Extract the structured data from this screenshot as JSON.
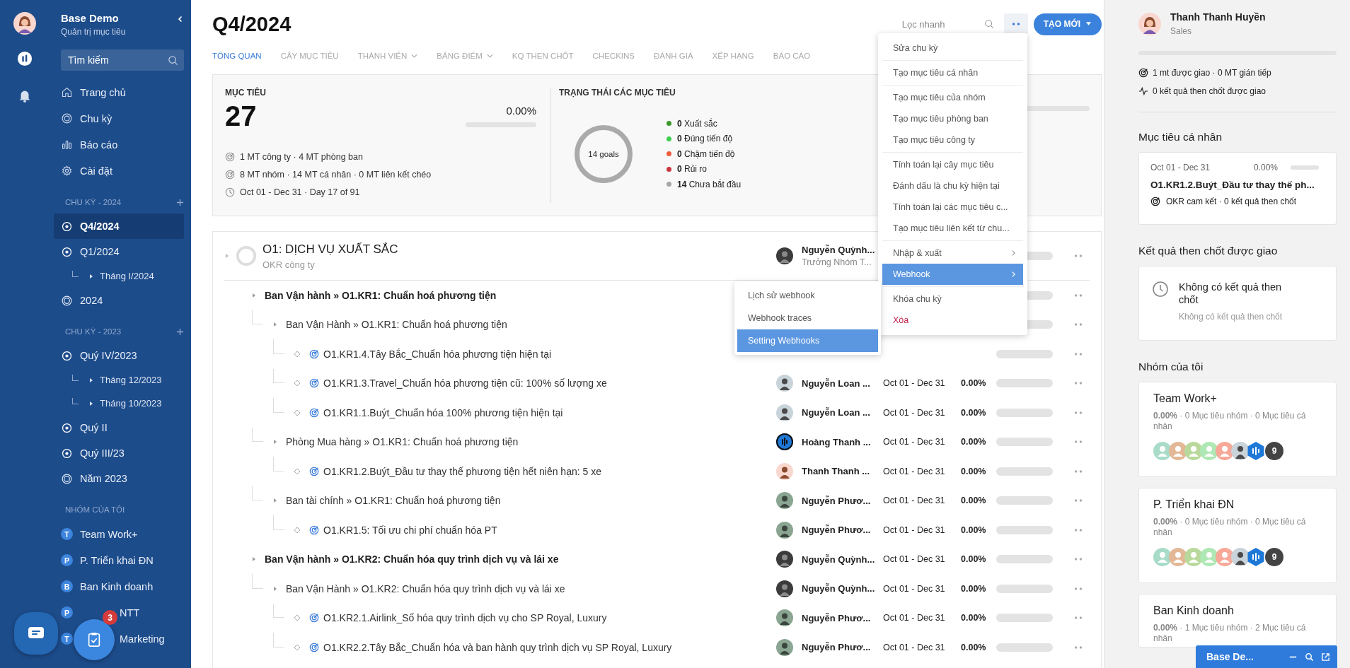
{
  "sidebar": {
    "title": "Base Demo",
    "subtitle": "Quản trị mục tiêu",
    "search": {
      "placeholder": "Tìm kiếm"
    },
    "nav": [
      {
        "label": "Trang chủ",
        "kind": "home"
      },
      {
        "label": "Chu kỳ",
        "kind": "cycle"
      },
      {
        "label": "Báo cáo",
        "kind": "report"
      },
      {
        "label": "Cài đặt",
        "kind": "settings"
      }
    ],
    "cycle_sections": [
      {
        "title": "CHU KỲ - 2024",
        "items": [
          {
            "label": "Q4/2024",
            "kind": "period",
            "selected": true
          },
          {
            "label": "Q1/2024",
            "kind": "period",
            "selected": false,
            "children": [
              {
                "label": "Tháng I/2024"
              }
            ]
          },
          {
            "label": "2024",
            "kind": "year",
            "selected": false
          }
        ]
      },
      {
        "title": "CHU KỲ - 2023",
        "items": [
          {
            "label": "Quý IV/2023",
            "kind": "period",
            "selected": false,
            "children": [
              {
                "label": "Tháng 12/2023"
              },
              {
                "label": "Tháng 10/2023"
              }
            ]
          },
          {
            "label": "Quý II",
            "kind": "period",
            "selected": false
          },
          {
            "label": "Quý III/23",
            "kind": "period",
            "selected": false
          },
          {
            "label": "Năm 2023",
            "kind": "year",
            "selected": false
          }
        ]
      }
    ],
    "groups_title": "NHÓM CỦA TÔI",
    "groups": [
      {
        "initial": "T",
        "label": "Team Work+"
      },
      {
        "initial": "P",
        "label": "P. Triển khai ĐN"
      },
      {
        "initial": "B",
        "label": "Ban Kinh doanh"
      },
      {
        "initial": "P",
        "label": "NTT"
      },
      {
        "initial": "T",
        "label": "Marketing"
      }
    ]
  },
  "floating": {
    "task_badge": "3"
  },
  "header": {
    "title": "Q4/2024",
    "filter": {
      "placeholder": "Lọc nhanh"
    },
    "create_button": "TẠO MỚI"
  },
  "tabs": [
    {
      "label": "TỔNG QUAN",
      "selected": true,
      "dropdown": false
    },
    {
      "label": "CÂY MỤC TIÊU",
      "selected": false,
      "dropdown": false
    },
    {
      "label": "THÀNH VIÊN",
      "selected": false,
      "dropdown": true
    },
    {
      "label": "BẢNG ĐIỂM",
      "selected": false,
      "dropdown": true
    },
    {
      "label": "KQ THEN CHỐT",
      "selected": false,
      "dropdown": false
    },
    {
      "label": "CHECKINS",
      "selected": false,
      "dropdown": false
    },
    {
      "label": "ĐÁNH GIÁ",
      "selected": false,
      "dropdown": false
    },
    {
      "label": "XẾP HẠNG",
      "selected": false,
      "dropdown": false
    },
    {
      "label": "BÁO CÁO",
      "selected": false,
      "dropdown": false
    }
  ],
  "summary": {
    "goals": {
      "title": "MỤC TIÊU",
      "count": "27",
      "percent": "0.00%",
      "level": 0,
      "lines": [
        {
          "kind": "target",
          "text": "1 MT công ty · 4 MT phòng ban"
        },
        {
          "kind": "target",
          "text": "8 MT nhóm · 14 MT cá nhân · 0 MT liên kết chéo"
        },
        {
          "kind": "clock",
          "text": "Oct 01 - Dec 31 · Day 17 of 91"
        }
      ]
    },
    "status": {
      "title": "TRẠNG THÁI CÁC MỤC TIÊU",
      "ring_label": "14 goals",
      "items": [
        {
          "count": "0",
          "label": "Xuất sắc",
          "color": "#3a9a2a"
        },
        {
          "count": "0",
          "label": "Đúng tiến độ",
          "color": "#3ccf4e"
        },
        {
          "count": "0",
          "label": "Chậm tiến độ",
          "color": "#ef5b3a"
        },
        {
          "count": "0",
          "label": "Rủi ro",
          "color": "#c9373f"
        },
        {
          "count": "14",
          "label": "Chưa bắt đầu",
          "color": "#a6a6a6"
        }
      ]
    },
    "column_3": {
      "level": 0
    }
  },
  "objective": {
    "title": "O1: DỊCH VỤ XUẤT SẮC",
    "subtitle": "OKR công ty",
    "owner": {
      "name": "Nguyễn Quỳnh...",
      "role": "Trưởng Nhóm T...",
      "kind": "dark"
    },
    "level": 0,
    "key_results": [
      {
        "kind": "branch",
        "label": "Ban Vận hành » O1.KR1: Chuẩn hoá phương tiện",
        "level": 0,
        "children": [
          {
            "kind": "branch",
            "label": "Ban Vận Hành » O1.KR1: Chuẩn hoá phương tiện",
            "level": 0,
            "children": [
              {
                "kind": "leaf",
                "label": "O1.KR1.4.Tây Bắc_Chuẩn hóa phương tiện hiện tại",
                "level": 0
              },
              {
                "kind": "leaf",
                "label": "O1.KR1.3.Travel_Chuẩn hóa phương tiện cũ: 100% số lượng xe",
                "owner": {
                  "name": "Nguyễn Loan ...",
                  "kind": "light"
                },
                "dates": "Oct 01 - Dec 31",
                "percent": "0.00%",
                "level": 0
              },
              {
                "kind": "leaf",
                "label": "O1.KR1.1.Buýt_Chuẩn hóa 100% phương tiện hiện tại",
                "owner": {
                  "name": "Nguyễn Loan ...",
                  "kind": "light"
                },
                "dates": "Oct 01 - Dec 31",
                "percent": "0.00%",
                "level": 0
              }
            ]
          },
          {
            "kind": "branch",
            "label": "Phòng Mua hàng » O1.KR1: Chuẩn hoá phương tiện",
            "owner": {
              "name": "Hoàng Thanh ...",
              "kind": "brand"
            },
            "dates": "Oct 01 - Dec 31",
            "percent": "0.00%",
            "level": 0,
            "children": [
              {
                "kind": "leaf",
                "label": "O1.KR1.2.Buýt_Đầu tư thay thế phương tiện hết niên hạn: 5 xe",
                "owner": {
                  "name": "Thanh Thanh ...",
                  "kind": "illustrated"
                },
                "dates": "Oct 01 - Dec 31",
                "percent": "0.00%",
                "level": 0
              }
            ]
          },
          {
            "kind": "branch",
            "label": "Ban tài chính » O1.KR1: Chuẩn hoá phương tiện",
            "owner": {
              "name": "Nguyễn Phươ...",
              "kind": "green"
            },
            "dates": "Oct 01 - Dec 31",
            "percent": "0.00%",
            "level": 0,
            "children": [
              {
                "kind": "leaf",
                "label": "O1.KR1.5: Tối ưu chi phí chuẩn hóa PT",
                "owner": {
                  "name": "Nguyễn Phươ...",
                  "kind": "green"
                },
                "dates": "Oct 01 - Dec 31",
                "percent": "0.00%",
                "level": 0
              }
            ]
          }
        ]
      },
      {
        "kind": "branch",
        "label": "Ban Vận hành » O1.KR2: Chuẩn hóa quy trình dịch vụ và lái xe",
        "owner": {
          "name": "Nguyễn Quỳnh...",
          "kind": "dark"
        },
        "dates": "Oct 01 - Dec 31",
        "percent": "0.00%",
        "level": 0,
        "children": [
          {
            "kind": "branch",
            "label": "Ban Vận Hành » O1.KR2: Chuẩn hóa quy trình dịch vụ và lái xe",
            "owner": {
              "name": "Nguyễn Quỳnh...",
              "kind": "dark"
            },
            "dates": "Oct 01 - Dec 31",
            "percent": "0.00%",
            "level": 0,
            "children": [
              {
                "kind": "leaf",
                "label": "O1.KR2.1.Airlink_Số hóa quy trình dịch vụ cho SP Royal, Luxury",
                "owner": {
                  "name": "Nguyễn Phươ...",
                  "kind": "green"
                },
                "dates": "Oct 01 - Dec 31",
                "percent": "0.00%",
                "level": 0
              },
              {
                "kind": "leaf",
                "label": "O1.KR2.2.Tây Bắc_Chuẩn hóa và ban hành quy trình dịch vụ SP Royal, Luxury",
                "owner": {
                  "name": "Nguyễn Phươ...",
                  "kind": "green"
                },
                "dates": "Oct 01 - Dec 31",
                "percent": "0.00%",
                "level": 0
              }
            ]
          }
        ]
      }
    ]
  },
  "menu": {
    "sections": [
      {
        "items": [
          {
            "label": "Sửa chu kỳ",
            "kind": "plain",
            "selected": false
          }
        ]
      },
      {
        "items": [
          {
            "label": "Tạo mục tiêu cá nhân",
            "kind": "plain",
            "selected": false
          }
        ]
      },
      {
        "items": [
          {
            "label": "Tạo mục tiêu của nhóm",
            "kind": "plain",
            "selected": false
          },
          {
            "label": "Tạo mục tiêu phòng ban",
            "kind": "plain",
            "selected": false
          },
          {
            "label": "Tạo mục tiêu công ty",
            "kind": "plain",
            "selected": false
          }
        ]
      },
      {
        "items": [
          {
            "label": "Tính toán lại cây mục tiêu",
            "kind": "plain",
            "selected": false
          },
          {
            "label": "Đánh dấu là chu kỳ hiện tại",
            "kind": "plain",
            "selected": false
          },
          {
            "label": "Tính toán lại các mục tiêu c...",
            "kind": "plain",
            "selected": false
          },
          {
            "label": "Tạo mục tiêu liên kết từ chu...",
            "kind": "plain",
            "selected": false
          }
        ]
      },
      {
        "items": [
          {
            "label": "Nhập & xuất",
            "kind": "parent",
            "selected": false
          },
          {
            "label": "Webhook",
            "kind": "parent",
            "selected": true
          }
        ]
      },
      {
        "items": [
          {
            "label": "Khóa chu kỳ",
            "kind": "plain",
            "selected": false
          },
          {
            "label": "Xóa",
            "kind": "danger",
            "selected": false
          }
        ]
      }
    ]
  },
  "submenu": {
    "items": [
      {
        "label": "Lịch sử webhook",
        "selected": false
      },
      {
        "label": "Webhook traces",
        "selected": false
      },
      {
        "label": "Setting Webhooks",
        "selected": true
      }
    ]
  },
  "profile": {
    "name": "Thanh Thanh Huyền",
    "role": "Sales",
    "level": 0,
    "stats": [
      {
        "kind": "target",
        "text": "1 mt được giao · 0 MT gián tiếp"
      },
      {
        "kind": "pulse",
        "text": "0 kết quả then chốt được giao"
      }
    ]
  },
  "personal_goals": {
    "title": "Mục tiêu cá nhân",
    "items": [
      {
        "dates": "Oct 01 - Dec 31",
        "percent": "0.00%",
        "level": 0,
        "title": "O1.KR1.2.Buýt_Đầu tư thay thế ph...",
        "meta": "OKR cam kết  ·  0 kết quả then chốt"
      }
    ]
  },
  "assigned_results": {
    "title": "Kết quả then chốt được giao",
    "empty_title": "Không có kết quả then chốt",
    "empty_text": "Không có kết quả then chốt"
  },
  "my_groups": {
    "title": "Nhóm của tôi",
    "items": [
      {
        "name": "Team Work+",
        "summary": "**0.00%** · 0 Mục tiêu nhóm · 0 Mục tiêu cá nhân",
        "members": [
          {
            "kind": "icon",
            "color": "#a8dcc9"
          },
          {
            "kind": "icon",
            "color": "#e3b896"
          },
          {
            "kind": "icon",
            "color": "#b9d99c"
          },
          {
            "kind": "icon",
            "color": "#aee8b4"
          },
          {
            "kind": "icon",
            "color": "#f7a898"
          },
          {
            "kind": "photo"
          },
          {
            "kind": "brand"
          }
        ],
        "more": "9"
      },
      {
        "name": "P. Triển khai ĐN",
        "summary": "**0.00%** · 0 Mục tiêu nhóm · 0 Mục tiêu cá nhân",
        "members": [
          {
            "kind": "icon",
            "color": "#a8dcc9"
          },
          {
            "kind": "icon",
            "color": "#e3b896"
          },
          {
            "kind": "icon",
            "color": "#b9d99c"
          },
          {
            "kind": "icon",
            "color": "#aee8b4"
          },
          {
            "kind": "icon",
            "color": "#f7a898"
          },
          {
            "kind": "photo"
          },
          {
            "kind": "brand"
          }
        ],
        "more": "9"
      },
      {
        "name": "Ban Kinh doanh",
        "summary": "**0.00%** · 1 Mục tiêu nhóm · 2 Mục tiêu cá nhân"
      }
    ]
  },
  "chat_widget": {
    "title": "Base De..."
  }
}
